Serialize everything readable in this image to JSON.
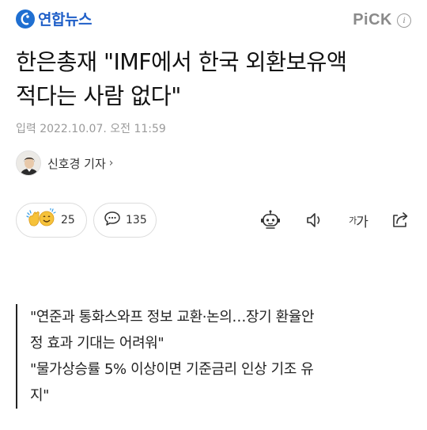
{
  "header": {
    "logo_text": "연합뉴스",
    "pick_label": "PiCK",
    "info_label": "i"
  },
  "article": {
    "title_line1": "한은총재 \"IMF에서 한국 외환보유액",
    "title_line2": "적다는 사람 없다\"",
    "date": "입력 2022.10.07. 오전 11:59",
    "reporter": "신호경 기자",
    "reporter_chevron": "›"
  },
  "actions": {
    "reaction_count": "25",
    "comment_count": "135",
    "font_label_small": "가",
    "font_label_large": "가"
  },
  "summary": {
    "line1": "\"연준과 통화스와프 정보 교환·논의…장기 환율안",
    "line2": "정 효과 기대는 어려워\"",
    "line3": "\"물가상승률 5% 이상이면 기준금리 인상 기조 유",
    "line4": "지\""
  },
  "colors": {
    "brand": "#1f5fc8",
    "muted": "#9a9a9a",
    "text": "#111111"
  },
  "icons": {
    "logo": "globe-logo-icon",
    "info": "info-icon",
    "reaction": "clap-and-smile-emoji-icon",
    "comment": "speech-bubble-icon",
    "tts": "robot-icon",
    "sound": "speaker-icon",
    "share": "share-icon"
  }
}
